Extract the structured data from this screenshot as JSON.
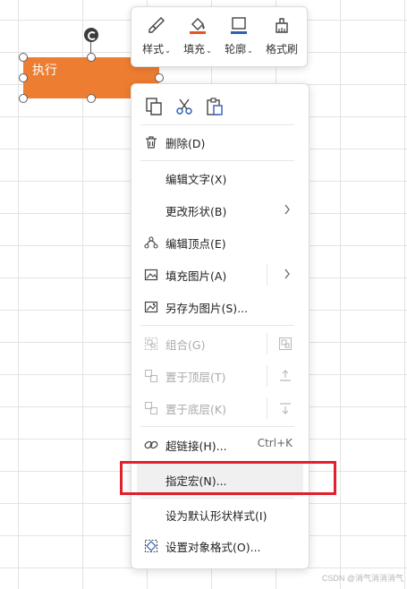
{
  "shape": {
    "text": "执行"
  },
  "mini_toolbar": {
    "buttons": [
      {
        "label": "样式",
        "icon": "brush-style-icon"
      },
      {
        "label": "填充",
        "icon": "fill-bucket-icon"
      },
      {
        "label": "轮廓",
        "icon": "outline-icon"
      },
      {
        "label": "格式刷",
        "icon": "format-painter-icon"
      }
    ],
    "colors": {
      "fill_underline": "#e8531f",
      "outline_underline": "#2f5fb6"
    }
  },
  "context_menu": {
    "clipboard": [
      "copy-icon",
      "cut-icon",
      "paste-icon"
    ],
    "items": {
      "delete": "删除(D)",
      "edit_text": "编辑文字(X)",
      "change_shape": "更改形状(B)",
      "edit_points": "编辑顶点(E)",
      "fill_picture": "填充图片(A)",
      "save_as_picture": "另存为图片(S)...",
      "group": "组合(G)",
      "bring_to_front": "置于顶层(T)",
      "send_to_back": "置于底层(K)",
      "hyperlink": "超链接(H)...",
      "hyperlink_shortcut": "Ctrl+K",
      "assign_macro": "指定宏(N)...",
      "set_default_style": "设为默认形状样式(I)",
      "format_object": "设置对象格式(O)..."
    }
  },
  "watermark": "CSDN @消气消消消气",
  "colors": {
    "shape_fill": "#ed7d31",
    "highlight_box": "#e0202a"
  }
}
